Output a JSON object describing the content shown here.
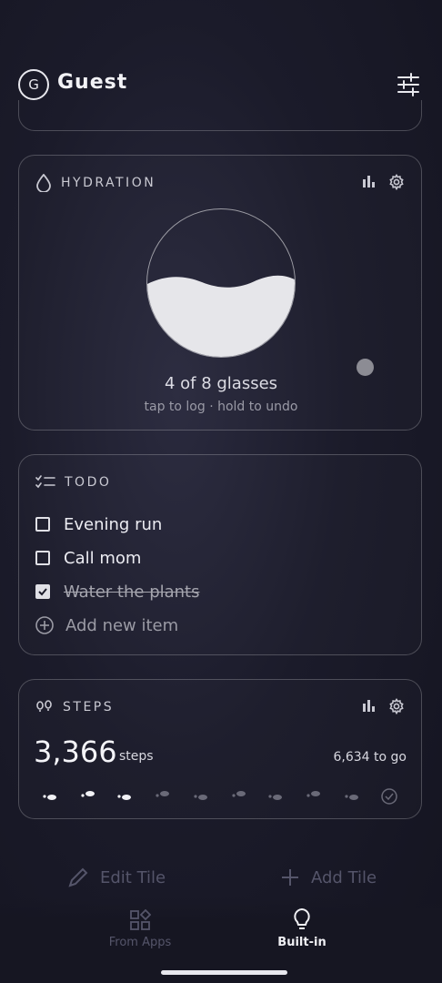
{
  "header": {
    "avatar_letter": "G",
    "username": "Guest",
    "settings_icon": "sliders-icon"
  },
  "hydration": {
    "title": "HYDRATION",
    "icon": "droplet-icon",
    "glasses_text": "4 of 8 glasses",
    "hint": "tap to log · hold to undo",
    "fill_level": 0.5,
    "chart_icon": "bar-chart-icon",
    "gear_icon": "gear-icon"
  },
  "todo": {
    "title": "TODO",
    "icon": "checklist-icon",
    "items": [
      {
        "label": "Evening run",
        "done": false
      },
      {
        "label": "Call mom",
        "done": false
      },
      {
        "label": "Water the plants",
        "done": true
      }
    ],
    "add_label": "Add new item"
  },
  "steps": {
    "title": "STEPS",
    "icon": "footprints-icon",
    "count": "3,366",
    "unit": "steps",
    "to_go": "6,634 to go",
    "progress_fraction": 0.34
  },
  "actions": {
    "edit_tile": "Edit Tile",
    "add_tile": "Add Tile"
  },
  "tabs": [
    {
      "label": "From Apps",
      "active": false,
      "icon": "apps-grid-icon"
    },
    {
      "label": "Built-in",
      "active": true,
      "icon": "lightbulb-icon"
    }
  ],
  "colors": {
    "background": "#1b1b2a",
    "accent": "#e8e8ee",
    "water": "#e6e6ea",
    "inactive": "#55556a"
  }
}
